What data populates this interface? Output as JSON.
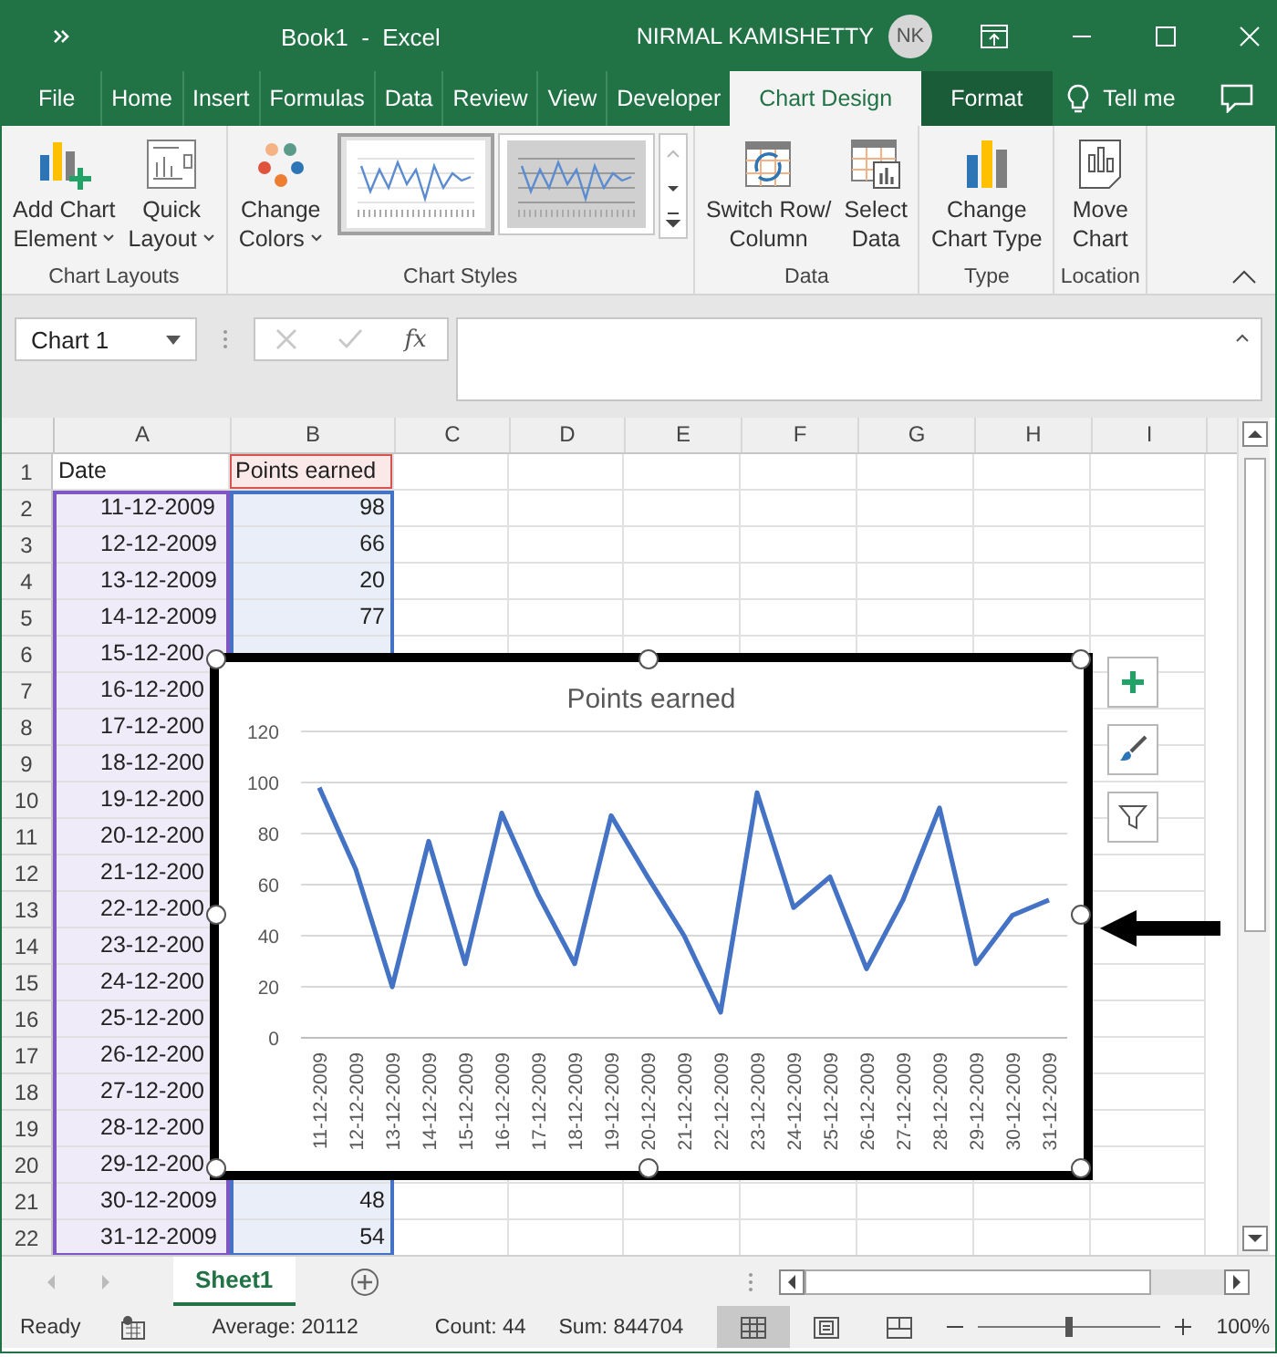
{
  "window": {
    "title": "Book1  -  Excel",
    "user": "NIRMAL KAMISHETTY",
    "avatar": "NK"
  },
  "ribbon_tabs": [
    {
      "label": "File",
      "kind": "standard",
      "selected": false
    },
    {
      "label": "Home",
      "kind": "standard",
      "selected": false
    },
    {
      "label": "Insert",
      "kind": "standard",
      "selected": false
    },
    {
      "label": "Formulas",
      "kind": "standard",
      "selected": false
    },
    {
      "label": "Data",
      "kind": "standard",
      "selected": false
    },
    {
      "label": "Review",
      "kind": "standard",
      "selected": false
    },
    {
      "label": "View",
      "kind": "standard",
      "selected": false
    },
    {
      "label": "Developer",
      "kind": "standard",
      "selected": false
    },
    {
      "label": "Chart Design",
      "kind": "contextual",
      "selected": true
    },
    {
      "label": "Format",
      "kind": "contextual",
      "selected": false
    }
  ],
  "tell_me": "Tell me",
  "ribbon_groups": [
    {
      "label": "Chart Layouts",
      "kind": "commands",
      "commands": [
        {
          "lines": [
            "Add Chart",
            "Element"
          ],
          "dropdown": true
        },
        {
          "lines": [
            "Quick",
            "Layout"
          ],
          "dropdown": true
        }
      ]
    },
    {
      "label": "Chart Styles",
      "kind": "gallery",
      "commands": [
        {
          "lines": [
            "Change",
            "Colors"
          ],
          "dropdown": true
        }
      ],
      "styles": [
        {
          "selected": true
        },
        {
          "selected": false
        }
      ]
    },
    {
      "label": "Data",
      "kind": "commands",
      "commands": [
        {
          "lines": [
            "Switch Row/",
            "Column"
          ],
          "dropdown": false
        },
        {
          "lines": [
            "Select",
            "Data"
          ],
          "dropdown": false
        }
      ]
    },
    {
      "label": "Type",
      "kind": "commands",
      "commands": [
        {
          "lines": [
            "Change",
            "Chart Type"
          ],
          "dropdown": false
        }
      ]
    },
    {
      "label": "Location",
      "kind": "commands",
      "commands": [
        {
          "lines": [
            "Move",
            "Chart"
          ],
          "dropdown": false
        }
      ]
    }
  ],
  "name_box": "Chart 1",
  "function_label": "fx",
  "columns": [
    {
      "label": "A",
      "color": "#7e57c2"
    },
    {
      "label": "B",
      "color": "#4472c4"
    },
    {
      "label": "C"
    },
    {
      "label": "D"
    },
    {
      "label": "E"
    },
    {
      "label": "F"
    },
    {
      "label": "G"
    },
    {
      "label": "H"
    },
    {
      "label": "I"
    }
  ],
  "rows": [
    {
      "number": "1",
      "cells": [
        "Date",
        "Points earned"
      ]
    },
    {
      "number": "2",
      "cells": [
        "11-12-2009",
        "98"
      ]
    },
    {
      "number": "3",
      "cells": [
        "12-12-2009",
        "66"
      ]
    },
    {
      "number": "4",
      "cells": [
        "13-12-2009",
        "20"
      ]
    },
    {
      "number": "5",
      "cells": [
        "14-12-2009",
        "77"
      ]
    },
    {
      "number": "6",
      "cells": [
        "15-12-200"
      ]
    },
    {
      "number": "7",
      "cells": [
        "16-12-200"
      ]
    },
    {
      "number": "8",
      "cells": [
        "17-12-200"
      ]
    },
    {
      "number": "9",
      "cells": [
        "18-12-200"
      ]
    },
    {
      "number": "10",
      "cells": [
        "19-12-200"
      ]
    },
    {
      "number": "11",
      "cells": [
        "20-12-200"
      ]
    },
    {
      "number": "12",
      "cells": [
        "21-12-200"
      ]
    },
    {
      "number": "13",
      "cells": [
        "22-12-200"
      ]
    },
    {
      "number": "14",
      "cells": [
        "23-12-200"
      ]
    },
    {
      "number": "15",
      "cells": [
        "24-12-200"
      ]
    },
    {
      "number": "16",
      "cells": [
        "25-12-200"
      ]
    },
    {
      "number": "17",
      "cells": [
        "26-12-200"
      ]
    },
    {
      "number": "18",
      "cells": [
        "27-12-200"
      ]
    },
    {
      "number": "19",
      "cells": [
        "28-12-200"
      ]
    },
    {
      "number": "20",
      "cells": [
        "29-12-200"
      ]
    },
    {
      "number": "21",
      "cells": [
        "30-12-2009",
        "48"
      ]
    },
    {
      "number": "22",
      "cells": [
        "31-12-2009",
        "54"
      ]
    }
  ],
  "chart": {
    "chart_data": {
      "type": "line",
      "title": "Points earned",
      "categories": [
        "11-12-2009",
        "12-12-2009",
        "13-12-2009",
        "14-12-2009",
        "15-12-2009",
        "16-12-2009",
        "17-12-2009",
        "18-12-2009",
        "19-12-2009",
        "20-12-2009",
        "21-12-2009",
        "22-12-2009",
        "23-12-2009",
        "24-12-2009",
        "25-12-2009",
        "26-12-2009",
        "27-12-2009",
        "28-12-2009",
        "29-12-2009",
        "30-12-2009",
        "31-12-2009"
      ],
      "series": [
        {
          "color": "#4472c4",
          "values": [
            98,
            66,
            20,
            77,
            29,
            88,
            56,
            29,
            87,
            63,
            40,
            10,
            96,
            51,
            63,
            27,
            54,
            90,
            29,
            48,
            54
          ]
        }
      ],
      "ylim": [
        0,
        120
      ],
      "yticks": [
        0,
        20,
        40,
        60,
        80,
        100,
        120
      ],
      "grid": true
    }
  },
  "sheet_tabs": [
    {
      "label": "Sheet1",
      "selected": true
    }
  ],
  "status_bar": {
    "mode": "Ready",
    "average": "Average: 20112",
    "count": "Count: 44",
    "sum": "Sum: 844704",
    "zoom": "100%",
    "zoom_slider": {
      "level": 0.5
    },
    "views": [
      {
        "selected": true
      },
      {
        "selected": false
      },
      {
        "selected": false
      }
    ]
  }
}
